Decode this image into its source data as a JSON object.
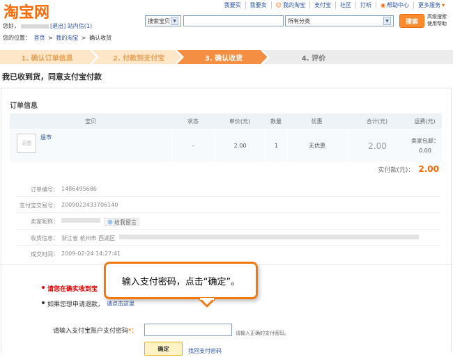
{
  "header": {
    "logo_text": "淘宝网",
    "greeting": "您好，",
    "logout": "[退出]",
    "inbox": "站内信(1)",
    "crumb_label": "您的位置：",
    "crumb_home": "首页",
    "crumb_sep": ">",
    "crumb_mytaobao": "我的淘宝",
    "crumb_current": "确认收货",
    "nav": [
      "我要买",
      "我要卖",
      "我的淘宝",
      "支付宝",
      "社区",
      "打听",
      "帮助中心",
      "更多服务"
    ],
    "search_scope": "搜索宝贝",
    "search_value": "",
    "category": "所有分类",
    "search_btn": "搜索",
    "adv_search": "高级搜索",
    "help_link": "使用帮助"
  },
  "steps": [
    {
      "label": "1. 确认订单信息",
      "state": "done"
    },
    {
      "label": "2. 付款到支付宝",
      "state": "done"
    },
    {
      "label": "3. 确认收货",
      "state": "current"
    },
    {
      "label": "4. 评价",
      "state": "todo"
    }
  ],
  "page_title": "我已收到货，同意支付宝付款",
  "order": {
    "section_title": "订单信息",
    "columns": [
      "宝贝",
      "状态",
      "单价(元)",
      "数量",
      "优惠",
      "合计(元)",
      "运费(元)"
    ],
    "row": {
      "thumb": "无图",
      "name": "遥市",
      "status": "-",
      "price": "2.00",
      "qty": "1",
      "discount": "无优惠",
      "total": "2.00",
      "shipping_line1": "卖家包邮：",
      "shipping_line2": "0.00"
    },
    "paid_label": "实付款(元)：",
    "paid_value": "2.00",
    "info": {
      "order_no_label": "订单编号：",
      "order_no": "1486495686",
      "alipay_no_label": "支付宝交易号：",
      "alipay_no": "2009022433706140",
      "seller_label": "卖家昵称：",
      "ww_label": "给我留言",
      "address_label": "收货信息：",
      "address": "浙江省  杭州市  西湖区",
      "time_label": "成交时间：",
      "time": "2009-02-24 14:27:41"
    }
  },
  "notice": {
    "warn": "请您在确实收到宝",
    "refund_text": "如果您想申请退款，",
    "refund_link": "请点击这里"
  },
  "password": {
    "label": "请输入支付宝账户支付密码",
    "required_mark": "*：",
    "hint": "请输入正确的支付密码。",
    "ok_btn": "确定",
    "find_link": "找回支付密码"
  },
  "callout": {
    "text": "输入支付密码，点击“确定”。"
  }
}
